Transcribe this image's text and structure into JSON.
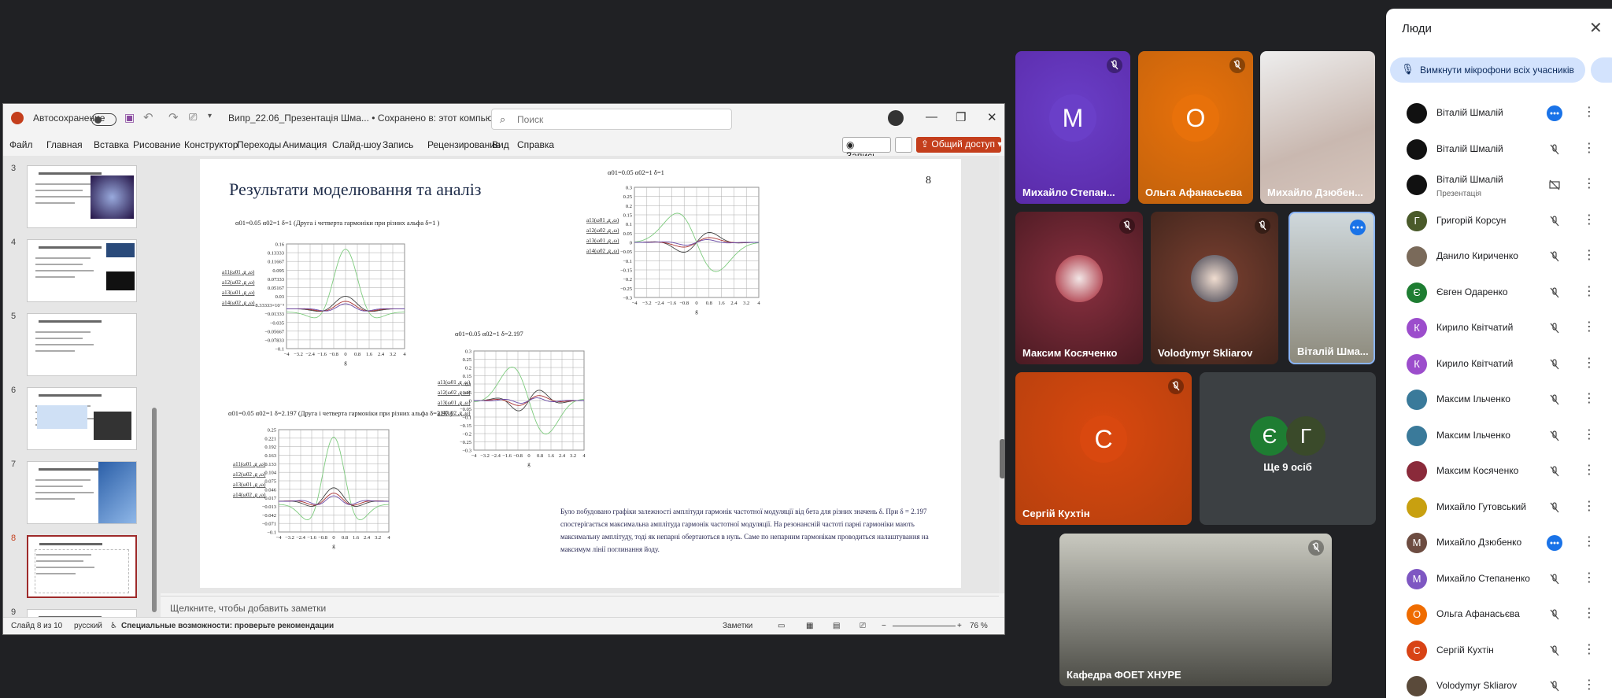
{
  "ppt": {
    "autosave_label": "Автосохранение",
    "doc_title": "Випр_22.06_Презентація Шма... • Сохранено в: этот компьютер",
    "search_placeholder": "Поиск",
    "ribbon_tabs": [
      "Файл",
      "Главная",
      "Вставка",
      "Рисование",
      "Конструктор",
      "Переходы",
      "Анимация",
      "Слайд-шоу",
      "Запись",
      "Рецензирование",
      "Вид",
      "Справка"
    ],
    "record_label": "Запись",
    "share_label": "Общий доступ",
    "thumb_numbers": [
      "3",
      "4",
      "5",
      "6",
      "7",
      "8",
      "9"
    ],
    "notes_placeholder": "Щелкните, чтобы добавить заметки",
    "status": {
      "slide": "Слайд 8 из 10",
      "lang": "русский",
      "access": "Специальные возможности: проверьте рекомендации",
      "notes": "Заметки",
      "zoom": "76 %"
    }
  },
  "slide": {
    "title": "Результати моделювання та аналіз",
    "number": "8",
    "cap1": "α01=0.05  α02=1 δ=1  (Друга і четверта гармоніки при різних альфа δ=1  )",
    "cap2": "α01=0.05  α02=1 δ=2.197  (Друга і четверта гармоніки при різних альфа δ=2.97  )",
    "cap3": "α01=0.05  α02=1 δ=2.197",
    "cap4": "α01=0.05   α02=1  δ=1",
    "legend": [
      "a11(ω01 ,g ,ω)",
      "a12(ω02 ,g ,ω)",
      "a13(ω01 ,g ,ω)",
      "a14(ω02 ,g ,ω)"
    ],
    "paragraph": "Було побудовано графіки залежності амплітуди гармонік частотної модуляції від бета для різних значень δ. При δ = 2.197 спостерігається максимальна амплітуда гармонік частотної модуляції. На резонансній частоті парні гармоніки мають максимальну амплітуду, тоді як непарні обертаються в нуль. Саме по непарним гармонікам проводиться налаштування на максимум лінії поглинання йоду.",
    "graph1_yticks": [
      "0.16",
      "0.13333",
      "0.11667",
      "0.095",
      "0.07333",
      "0.05167",
      "0.03",
      "8.33333×10⁻³",
      "−0.01333",
      "−0.035",
      "−0.05667",
      "−0.07833",
      "−0.1"
    ],
    "graph2_yticks": [
      "0.25",
      "0.221",
      "0.192",
      "0.163",
      "0.133",
      "0.104",
      "0.075",
      "0.046",
      "0.017",
      "−0.013",
      "−0.042",
      "−0.071",
      "−0.1"
    ],
    "graph3_yticks": [
      "0.3",
      "0.25",
      "0.2",
      "0.15",
      "0.1",
      "0.05",
      "0",
      "−0.05",
      "−0.1",
      "−0.15",
      "−0.2",
      "−0.25",
      "−0.3"
    ],
    "graph4_yticks": [
      "0.3",
      "0.25",
      "0.2",
      "0.15",
      "0.1",
      "0.05",
      "0",
      "−0.05",
      "−0.1",
      "−0.15",
      "−0.2",
      "−0.25",
      "−0.3"
    ],
    "xticks": [
      "−4",
      "−3.2",
      "−2.4",
      "−1.6",
      "−0.8",
      "0",
      "0.8",
      "1.6",
      "2.4",
      "3.2",
      "4"
    ],
    "xlabel": "g"
  },
  "tiles": [
    {
      "name": "Михайло Степан...",
      "letter": "М",
      "color": "#6a3fc8",
      "bg": "#5a2aa8"
    },
    {
      "name": "Ольга Афанасьєва",
      "letter": "О",
      "color": "#e8710a",
      "bg": "#c2620d"
    },
    {
      "name": "Михайло Дзюбен..."
    },
    {
      "name": "Максим Косяченко"
    },
    {
      "name": "Volodymyr Skliarov"
    },
    {
      "name": "Віталій Шма..."
    },
    {
      "name": "Сергій Кухтін",
      "letter": "С",
      "color": "#d9480f",
      "bg": "#b5400d"
    },
    {
      "name": "Ще 9 осіб",
      "letter1": "Є",
      "letter2": "Г"
    },
    {
      "name": "Кафедра ФОЕТ ХНУРЕ"
    }
  ],
  "panel": {
    "title": "Люди",
    "mute_all": "Вимкнути мікрофони всіх учасників",
    "people": [
      {
        "name": "Віталій Шмалій",
        "av": "",
        "color": "#111111",
        "state": "more"
      },
      {
        "name": "Віталій Шмалій",
        "av": "",
        "color": "#111111",
        "state": "mic"
      },
      {
        "name": "Віталій Шмалій",
        "sub": "Презентація",
        "av": "",
        "color": "#111111",
        "state": "present"
      },
      {
        "name": "Григорій Корсун",
        "av": "Г",
        "color": "#4a5a2a",
        "state": "mic"
      },
      {
        "name": "Данило Кириченко",
        "av": "",
        "color": "#7a6a5a",
        "state": "mic"
      },
      {
        "name": "Євген Одаренко",
        "av": "Є",
        "color": "#1e7d32",
        "state": "mic"
      },
      {
        "name": "Кирило Квітчатий",
        "av": "К",
        "color": "#9c4dcc",
        "state": "mic"
      },
      {
        "name": "Кирило Квітчатий",
        "av": "К",
        "color": "#9c4dcc",
        "state": "mic"
      },
      {
        "name": "Максим Ільченко",
        "av": "",
        "color": "#3a7a9a",
        "state": "mic"
      },
      {
        "name": "Максим Ільченко",
        "av": "",
        "color": "#3a7a9a",
        "state": "mic"
      },
      {
        "name": "Максим Косяченко",
        "av": "",
        "color": "#8a2a3a",
        "state": "mic"
      },
      {
        "name": "Михайло Гутовський",
        "av": "",
        "color": "#c8a010",
        "state": "mic"
      },
      {
        "name": "Михайло Дзюбенко",
        "av": "М",
        "color": "#6d4c41",
        "state": "more"
      },
      {
        "name": "Михайло Степаненко",
        "av": "М",
        "color": "#7e57c2",
        "state": "mic"
      },
      {
        "name": "Ольга Афанасьєва",
        "av": "О",
        "color": "#ef6c00",
        "state": "mic"
      },
      {
        "name": "Сергій Кухтін",
        "av": "С",
        "color": "#d84315",
        "state": "mic"
      },
      {
        "name": "Volodymyr Skliarov",
        "av": "",
        "color": "#5a4a3a",
        "state": "mic"
      }
    ]
  }
}
